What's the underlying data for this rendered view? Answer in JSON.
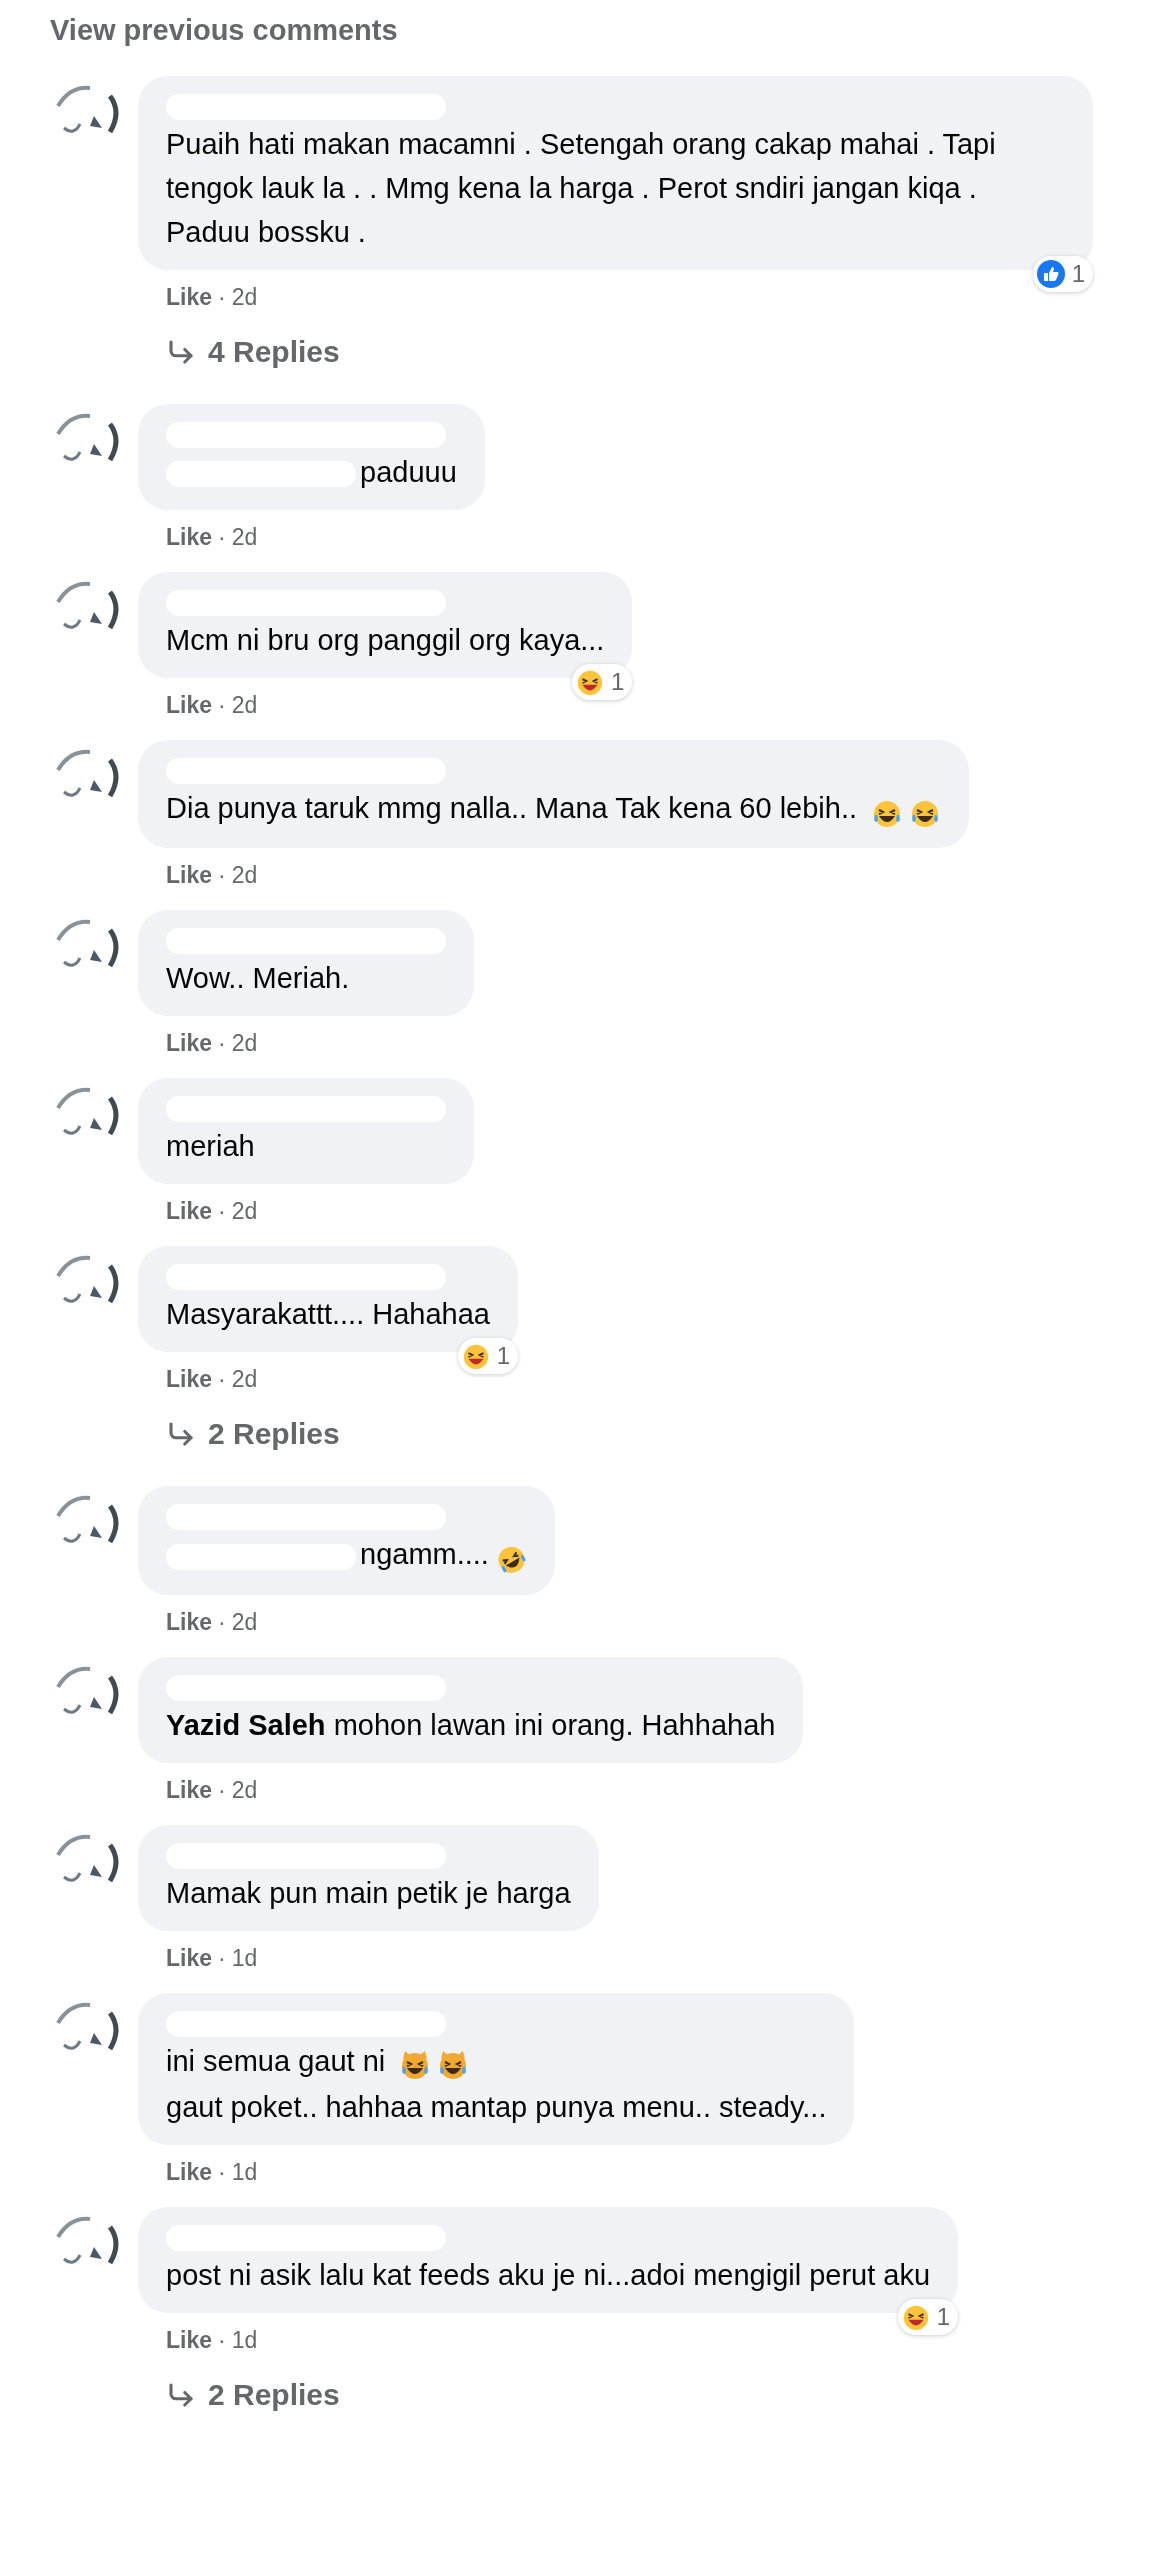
{
  "view_previous": "View previous comments",
  "comments": [
    {
      "body": [
        {
          "kind": "text",
          "text": "Puaih hati makan macamni . Setengah orang cakap mahai . Tapi tengok lauk la . . Mmg kena la harga . Perot sndiri jangan kiqa . Paduu bossku ."
        }
      ],
      "reaction": {
        "kind": "like",
        "count": "1"
      },
      "like": "Like",
      "separator": "·",
      "time": "2d",
      "replies": "4 Replies"
    },
    {
      "body": [
        {
          "kind": "redacted"
        },
        {
          "kind": "text",
          "text": "paduuu"
        }
      ],
      "like": "Like",
      "separator": "·",
      "time": "2d"
    },
    {
      "body": [
        {
          "kind": "text",
          "text": "Mcm ni bru org panggil org kaya..."
        }
      ],
      "reaction": {
        "kind": "haha",
        "count": "1"
      },
      "like": "Like",
      "separator": "·",
      "time": "2d"
    },
    {
      "body": [
        {
          "kind": "text",
          "text": "Dia punya taruk mmg nalla.. Mana Tak kena 60 lebih.. "
        },
        {
          "kind": "cry-laugh"
        },
        {
          "kind": "cry-laugh"
        }
      ],
      "like": "Like",
      "separator": "·",
      "time": "2d"
    },
    {
      "body": [
        {
          "kind": "text",
          "text": "Wow.. Meriah."
        }
      ],
      "like": "Like",
      "separator": "·",
      "time": "2d"
    },
    {
      "body": [
        {
          "kind": "text",
          "text": "meriah"
        }
      ],
      "like": "Like",
      "separator": "·",
      "time": "2d"
    },
    {
      "body": [
        {
          "kind": "text",
          "text": "Masyarakattt.... Hahahaa"
        }
      ],
      "reaction": {
        "kind": "haha",
        "count": "1"
      },
      "like": "Like",
      "separator": "·",
      "time": "2d",
      "replies": "2 Replies"
    },
    {
      "body": [
        {
          "kind": "redacted"
        },
        {
          "kind": "text",
          "text": "ngamm...."
        },
        {
          "kind": "rofl"
        }
      ],
      "like": "Like",
      "separator": "·",
      "time": "2d"
    },
    {
      "body": [
        {
          "kind": "text",
          "text": "**Yazid Saleh** mohon lawan ini orang. Hahhahah"
        }
      ],
      "like": "Like",
      "separator": "·",
      "time": "2d"
    },
    {
      "body": [
        {
          "kind": "text",
          "text": "Mamak pun main petik je harga"
        }
      ],
      "like": "Like",
      "separator": "·",
      "time": "1d"
    },
    {
      "body": [
        {
          "kind": "text",
          "text": "ini semua gaut ni "
        },
        {
          "kind": "cat-laugh"
        },
        {
          "kind": "cat-laugh"
        },
        {
          "kind": "break"
        },
        {
          "kind": "text",
          "text": "gaut poket.. hahhaa mantap punya menu.. steady..."
        }
      ],
      "like": "Like",
      "separator": "·",
      "time": "1d"
    },
    {
      "body": [
        {
          "kind": "text",
          "text": "post ni asik lalu kat feeds aku je ni...adoi mengigil perut aku"
        }
      ],
      "reaction": {
        "kind": "haha",
        "count": "1"
      },
      "like": "Like",
      "separator": "·",
      "time": "1d",
      "replies": "2 Replies"
    }
  ]
}
